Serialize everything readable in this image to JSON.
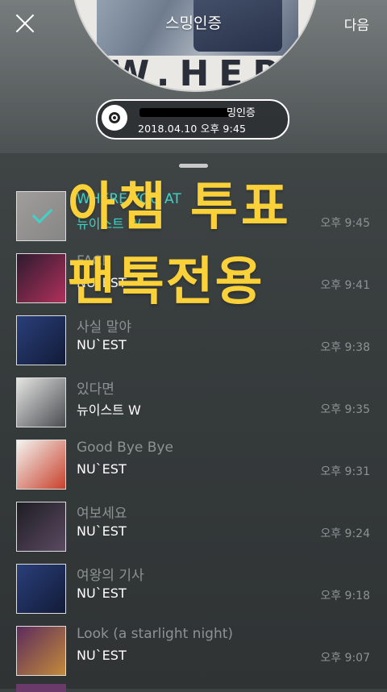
{
  "header": {
    "title": "스밍인증",
    "next_label": "다음"
  },
  "album_cover_text": "W.HER",
  "capsule": {
    "label": "밍인증",
    "datetime": "2018.04.10 오후 9:45"
  },
  "overlay": {
    "line1": "아챔 투표",
    "line2": "팬톡전용"
  },
  "songs": [
    {
      "title": "WHERE YOU AT",
      "artist": "뉴이스트 W",
      "time": "오후 9:45",
      "selected": true,
      "art": [
        "#b8b2ac",
        "#7f7f7f"
      ]
    },
    {
      "title": "FACE",
      "artist": "NU`EST",
      "time": "오후 9:41",
      "selected": false,
      "art": [
        "#2d1b2f",
        "#b0305a"
      ]
    },
    {
      "title": "사실 말야",
      "artist": "NU`EST",
      "time": "오후 9:38",
      "selected": false,
      "art": [
        "#2a3f7a",
        "#121b38"
      ]
    },
    {
      "title": "있다면",
      "artist": "뉴이스트 W",
      "time": "오후 9:35",
      "selected": false,
      "art": [
        "#e4e4e2",
        "#4a4c50"
      ]
    },
    {
      "title": "Good Bye Bye",
      "artist": "NU`EST",
      "time": "오후 9:31",
      "selected": false,
      "art": [
        "#f4f4f0",
        "#c8402c"
      ]
    },
    {
      "title": "여보세요",
      "artist": "NU`EST",
      "time": "오후 9:24",
      "selected": false,
      "art": [
        "#1e1d24",
        "#5c4a62"
      ]
    },
    {
      "title": "여왕의 기사",
      "artist": "NU`EST",
      "time": "오후 9:18",
      "selected": false,
      "art": [
        "#2a3f7a",
        "#121b38"
      ]
    },
    {
      "title": "Look (a starlight night)",
      "artist": "NU`EST",
      "time": "오후 9:07",
      "selected": false,
      "art": [
        "#5c2c5c",
        "#c48a3a"
      ]
    }
  ],
  "colors": {
    "accent": "#3fd3c8",
    "overlay_text": "#fbd13a"
  }
}
